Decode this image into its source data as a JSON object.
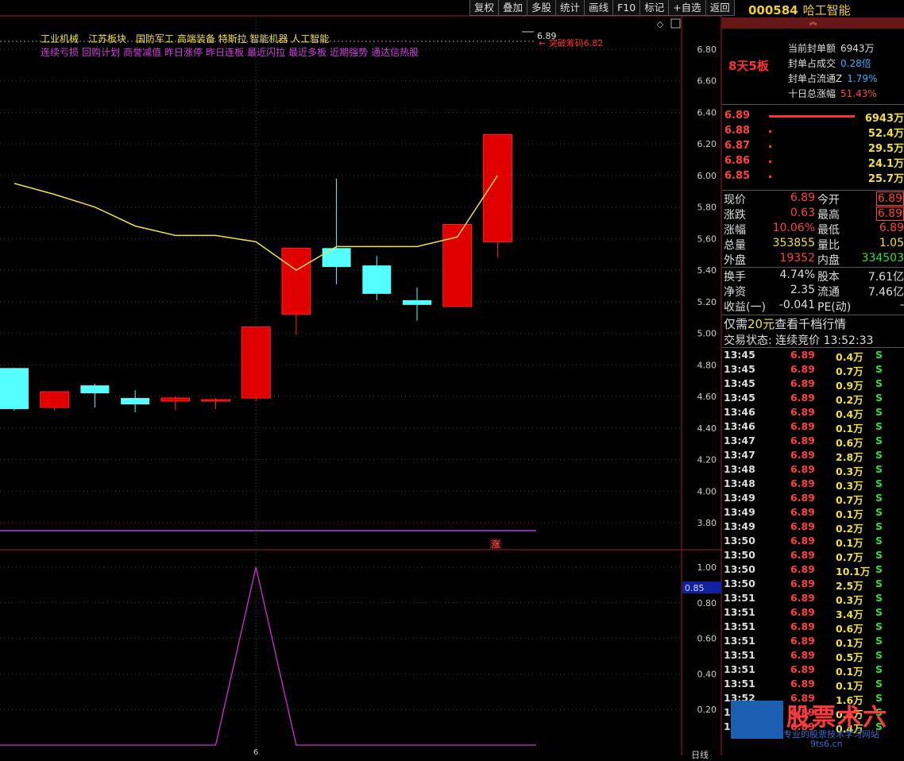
{
  "toolbar": {
    "buttons": [
      "复权",
      "叠加",
      "多股",
      "统计",
      "画线",
      "F10",
      "标记",
      "+自选",
      "返回"
    ]
  },
  "tags": {
    "line1": [
      "工业机械",
      "江苏板块",
      "国防军工 高端装备 特斯拉 智能机器 人工智能"
    ],
    "line2": [
      "连续亏损",
      "回购计划",
      "商誉减值",
      "昨日涨停",
      "昨日连板",
      "最近闪拉",
      "最近多板",
      "近期强势",
      "通达信热股"
    ]
  },
  "annotations": {
    "breakout_label": "突破筹码6.82",
    "peak_price_label": "6.89",
    "limit_marker": "涨",
    "indicator_value": "0.85",
    "date_marker": "6",
    "period": "日线"
  },
  "chart_data": [
    {
      "type": "candlestick",
      "ylim": [
        3.7,
        6.9
      ],
      "y_ticks": [
        "6.80",
        "6.60",
        "6.40",
        "6.20",
        "6.00",
        "5.80",
        "5.60",
        "5.40",
        "5.20",
        "5.00",
        "4.80",
        "4.60",
        "4.40",
        "4.20",
        "4.00",
        "3.80"
      ],
      "candles": [
        {
          "open": 4.78,
          "close": 4.52,
          "high": 4.78,
          "low": 4.51
        },
        {
          "open": 4.53,
          "close": 4.63,
          "high": 4.63,
          "low": 4.51
        },
        {
          "open": 4.67,
          "close": 4.62,
          "high": 4.68,
          "low": 4.53
        },
        {
          "open": 4.59,
          "close": 4.55,
          "high": 4.64,
          "low": 4.5
        },
        {
          "open": 4.57,
          "close": 4.59,
          "high": 4.6,
          "low": 4.51
        },
        {
          "open": 4.57,
          "close": 4.58,
          "high": 4.59,
          "low": 4.52
        },
        {
          "open": 4.59,
          "close": 5.04,
          "high": 5.04,
          "low": 4.57
        },
        {
          "open": 5.12,
          "close": 5.54,
          "high": 5.54,
          "low": 4.99
        },
        {
          "open": 5.54,
          "close": 5.42,
          "high": 5.98,
          "low": 5.31
        },
        {
          "open": 5.43,
          "close": 5.25,
          "high": 5.49,
          "low": 5.21
        },
        {
          "open": 5.21,
          "close": 5.18,
          "high": 5.29,
          "low": 5.08
        },
        {
          "open": 5.17,
          "close": 5.69,
          "high": 5.69,
          "low": 5.17
        },
        {
          "open": 5.58,
          "close": 6.26,
          "high": 6.26,
          "low": 5.48
        }
      ],
      "ma": [
        5.95,
        5.88,
        5.8,
        5.68,
        5.62,
        5.62,
        5.58,
        5.4,
        5.55,
        5.55,
        5.55,
        5.61,
        6.0
      ],
      "ma_color": "#f0e040",
      "up_color": "#ff2020",
      "down_color": "#54ffff"
    },
    {
      "type": "line",
      "ylim": [
        0,
        1.1
      ],
      "y_ticks": [
        "1.00",
        "0.80",
        "0.60",
        "0.40",
        "0.20"
      ],
      "values": [
        0,
        0,
        0,
        0,
        0,
        0,
        1.0,
        0,
        0,
        0,
        0,
        0,
        0
      ],
      "color": "#d030d0"
    }
  ],
  "quote": {
    "code": "000584",
    "name": "哈工智能",
    "badge": "8天5板",
    "seal": [
      {
        "label": "当前封单额",
        "value": "6943万",
        "color": "#ddd"
      },
      {
        "label": "封单占成交",
        "value": "0.28倍",
        "color": "#3ab0ff"
      },
      {
        "label": "封单占流通Z",
        "value": "1.79%",
        "color": "#3ab0ff"
      },
      {
        "label": "十日总涨幅",
        "value": "51.43%",
        "color": "#ff4040"
      }
    ],
    "orderbook": [
      {
        "price": "6.89",
        "qty": "6943万",
        "bar": 1.0
      },
      {
        "price": "6.88",
        "qty": "52.4万",
        "bar": 0.01
      },
      {
        "price": "6.87",
        "qty": "29.5万",
        "bar": 0.01
      },
      {
        "price": "6.86",
        "qty": "24.1万",
        "bar": 0.01
      },
      {
        "price": "6.85",
        "qty": "25.7万",
        "bar": 0.01
      }
    ],
    "stats": [
      {
        "l1": "现价",
        "v1": "6.89",
        "c1": "red",
        "l2": "今开",
        "v2": "6.89",
        "c2": "red",
        "box": true
      },
      {
        "l1": "涨跌",
        "v1": "0.63",
        "c1": "red",
        "l2": "最高",
        "v2": "6.89",
        "c2": "red",
        "box": true
      },
      {
        "l1": "涨幅",
        "v1": "10.06%",
        "c1": "red",
        "l2": "最低",
        "v2": "6.89",
        "c2": "red",
        "box": false
      },
      {
        "l1": "总量",
        "v1": "353855",
        "c1": "yel",
        "l2": "量比",
        "v2": "1.05",
        "c2": "yel",
        "box": false
      },
      {
        "l1": "外盘",
        "v1": "19352",
        "c1": "red",
        "l2": "内盘",
        "v2": "334503",
        "c2": "grn",
        "box": false
      },
      {
        "l1": "换手",
        "v1": "4.74%",
        "c1": "wht",
        "l2": "股本",
        "v2": "7.61亿",
        "c2": "wht",
        "box": false
      },
      {
        "l1": "净资",
        "v1": "2.35",
        "c1": "wht",
        "l2": "流通",
        "v2": "7.46亿",
        "c2": "wht",
        "box": false
      },
      {
        "l1": "收益(一)",
        "v1": "-0.041",
        "c1": "wht",
        "l2": "PE(动)",
        "v2": "-",
        "c2": "wht",
        "box": false
      }
    ],
    "notice_pre": "仅需",
    "notice_amount": "20元",
    "notice_post": "查看千档行情",
    "status": "交易状态: 连续竞价 13:52:33"
  },
  "ticks": [
    [
      "13:45",
      "6.89",
      "0.4万",
      "S"
    ],
    [
      "13:45",
      "6.89",
      "0.7万",
      "S"
    ],
    [
      "13:45",
      "6.89",
      "0.9万",
      "S"
    ],
    [
      "13:45",
      "6.89",
      "0.2万",
      "S"
    ],
    [
      "13:46",
      "6.89",
      "0.4万",
      "S"
    ],
    [
      "13:46",
      "6.89",
      "0.1万",
      "S"
    ],
    [
      "13:47",
      "6.89",
      "0.6万",
      "S"
    ],
    [
      "13:47",
      "6.89",
      "2.8万",
      "S"
    ],
    [
      "13:48",
      "6.89",
      "0.3万",
      "S"
    ],
    [
      "13:48",
      "6.89",
      "0.3万",
      "S"
    ],
    [
      "13:49",
      "6.89",
      "0.7万",
      "S"
    ],
    [
      "13:49",
      "6.89",
      "0.1万",
      "S"
    ],
    [
      "13:49",
      "6.89",
      "0.2万",
      "S"
    ],
    [
      "13:50",
      "6.89",
      "0.1万",
      "S"
    ],
    [
      "13:50",
      "6.89",
      "0.7万",
      "S"
    ],
    [
      "13:50",
      "6.89",
      "10.1万",
      "S"
    ],
    [
      "13:50",
      "6.89",
      "2.5万",
      "S"
    ],
    [
      "13:51",
      "6.89",
      "0.3万",
      "S"
    ],
    [
      "13:51",
      "6.89",
      "3.4万",
      "S"
    ],
    [
      "13:51",
      "6.89",
      "0.6万",
      "S"
    ],
    [
      "13:51",
      "6.89",
      "0.1万",
      "S"
    ],
    [
      "13:51",
      "6.89",
      "0.5万",
      "S"
    ],
    [
      "13:51",
      "6.89",
      "0.1万",
      "S"
    ],
    [
      "13:51",
      "6.89",
      "0.1万",
      "S"
    ],
    [
      "13:52",
      "6.89",
      "1.6万",
      "S"
    ],
    [
      "13:52",
      "6.89",
      "0.3万",
      "S"
    ],
    [
      "13:52",
      "6.89",
      "0.4万",
      "S"
    ]
  ],
  "watermark": {
    "title": "股票术六",
    "subtitle": "专业的股票技术学习网站",
    "url": "9ts6.cn"
  }
}
